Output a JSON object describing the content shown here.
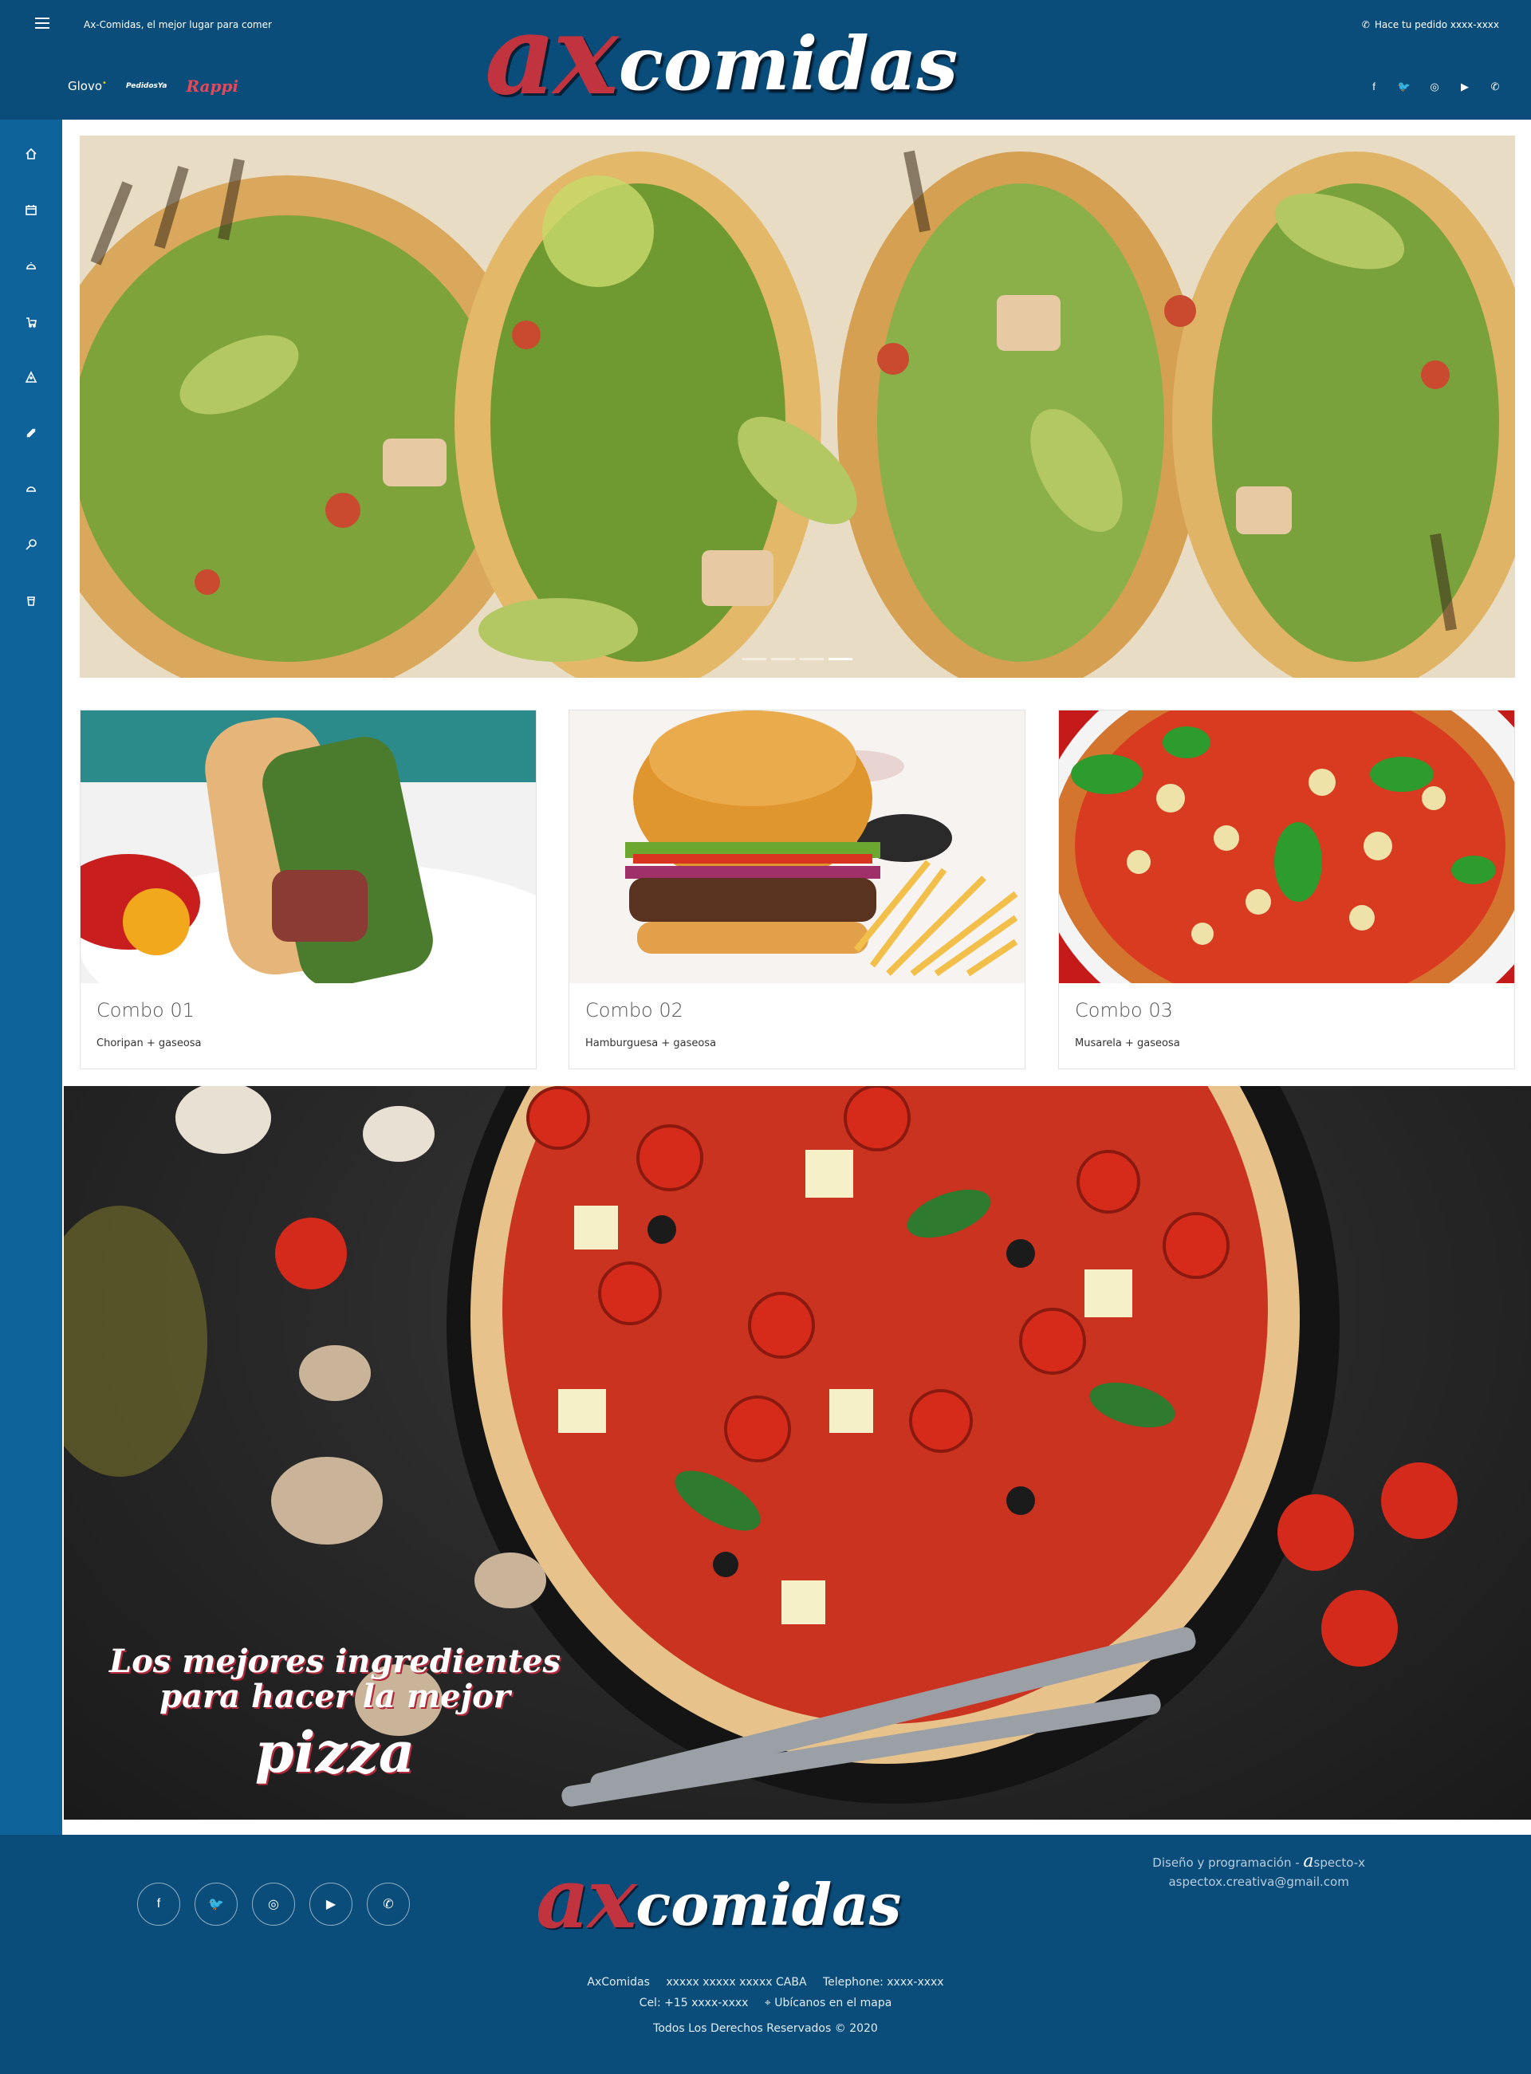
{
  "header": {
    "tagline": "Ax-Comidas, el mejor lugar para comer",
    "logo_ax": "ax",
    "logo_comidas": "comidas",
    "order_text": "Hace tu pedido xxxx-xxxx",
    "delivery": {
      "glovo": "Glovo",
      "pedidosya": "PedidosYa",
      "rappi": "Rappi"
    },
    "social_icons": [
      "facebook-icon",
      "twitter-icon",
      "instagram-icon",
      "youtube-icon",
      "whatsapp-icon"
    ]
  },
  "sidebar": {
    "items": [
      "home-icon",
      "calendar-icon",
      "cloche-icon",
      "delivery-icon",
      "pizza-icon",
      "food-icon",
      "dish-icon",
      "search-icon",
      "drink-icon"
    ]
  },
  "hero": {
    "slides": 4,
    "active_slide": 4
  },
  "combos": [
    {
      "title": "Combo 01",
      "desc": "Choripan + gaseosa"
    },
    {
      "title": "Combo 02",
      "desc": "Hamburguesa + gaseosa"
    },
    {
      "title": "Combo 03",
      "desc": "Musarela + gaseosa"
    }
  ],
  "banner": {
    "line1": "Los mejores ingredientes",
    "line2": "para hacer la mejor",
    "line3": "pizza"
  },
  "footer": {
    "logo_ax": "ax",
    "logo_comidas": "comidas",
    "credits_prefix": "Diseño y programación - ",
    "credits_brand": "a",
    "credits_brand_rest": "specto-x",
    "email": "aspectox.creativa@gmail.com",
    "name": "AxComidas",
    "address": "xxxxx xxxxx xxxxx CABA",
    "telephone": "Telephone: xxxx-xxxx",
    "cel": "Cel: +15 xxxx-xxxx",
    "map": "Ubícanos en el mapa",
    "rights": "Todos Los Derechos Reservados © 2020"
  }
}
